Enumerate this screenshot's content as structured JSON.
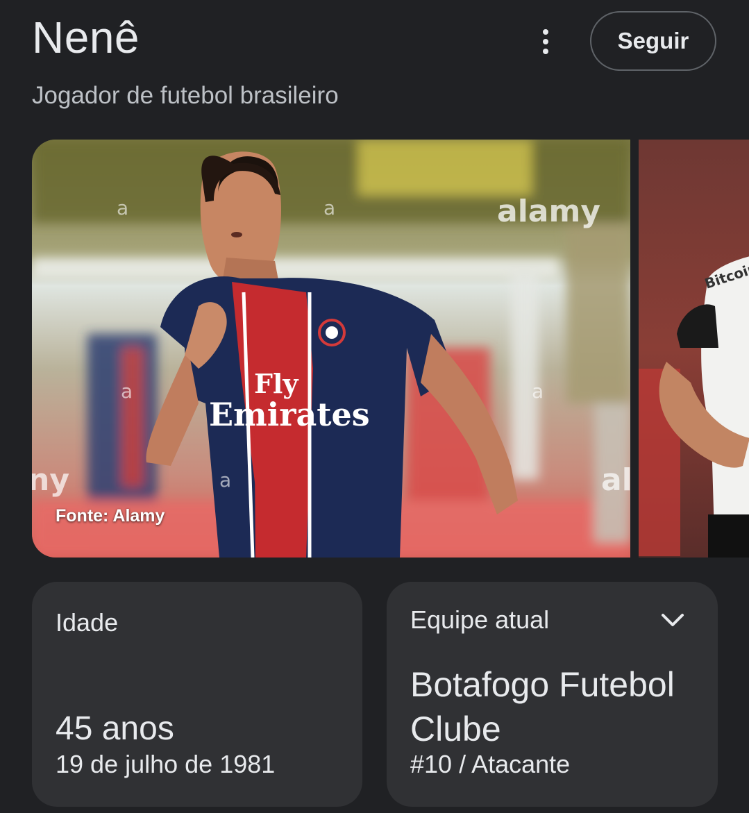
{
  "header": {
    "title": "Nenê",
    "subtitle": "Jogador de futebol brasileiro",
    "follow_label": "Seguir",
    "more_icon": "more-vert-icon"
  },
  "carousel": {
    "main_caption": "Fonte: Alamy",
    "main_jersey_sponsor_line1": "Fly",
    "main_jersey_sponsor_line2": "Emirates",
    "main_watermark": "alamy",
    "side_jersey_sponsor": "Bitcoin"
  },
  "cards": {
    "age": {
      "label": "Idade",
      "value": "45 anos",
      "birth_date": "19 de julho de 1981"
    },
    "team": {
      "label": "Equipe atual",
      "name": "Botafogo Futebol Clube",
      "role": "#10 / Atacante",
      "expand_icon": "chevron-down-icon"
    }
  },
  "colors": {
    "background": "#202124",
    "card": "#303134",
    "text": "#e8eaed",
    "secondary_text": "#bdc1c6",
    "outline": "#5f6368"
  }
}
